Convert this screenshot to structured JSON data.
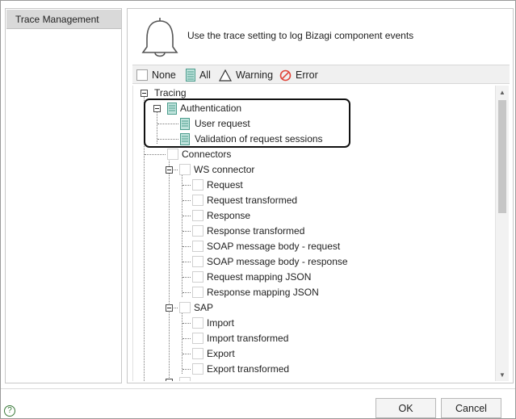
{
  "nav": {
    "items": [
      {
        "label": "Trace Management"
      }
    ]
  },
  "header": {
    "description": "Use the trace setting to log Bizagi component events"
  },
  "legend": {
    "none": "None",
    "all": "All",
    "warning": "Warning",
    "error": "Error",
    "colors": {
      "all": "#6cb7a8",
      "warning": "#333333",
      "error": "#e0463a"
    }
  },
  "tree": {
    "root": "Tracing",
    "authentication": "Authentication",
    "user_request": "User request",
    "validation": "Validation of request sessions",
    "connectors": "Connectors",
    "ws_connector": "WS connector",
    "ws_children": [
      "Request",
      "Request transformed",
      "Response",
      "Response transformed",
      "SOAP message body - request",
      "SOAP message body - response",
      "Request mapping JSON",
      "Response mapping JSON"
    ],
    "sap": "SAP",
    "sap_children": [
      "Import",
      "Import transformed",
      "Export",
      "Export transformed"
    ]
  },
  "footer": {
    "help": "?",
    "ok": "OK",
    "cancel": "Cancel"
  }
}
